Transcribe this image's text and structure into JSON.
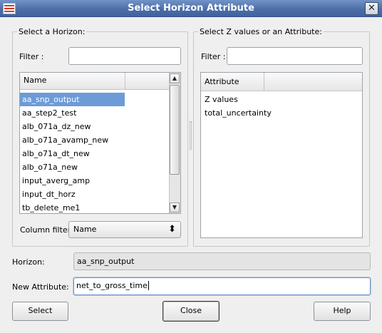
{
  "window": {
    "title": "Select Horizon Attribute",
    "close_glyph": "✕"
  },
  "left_group": {
    "title": "Select a Horizon:",
    "filter_label": "Filter :",
    "filter_value": "",
    "column_header": "Name",
    "items": [
      "aa_snp_output",
      "aa_step2_test",
      "alb_071a_dz_new",
      "alb_o71a_avamp_new",
      "alb_o71a_dt_new",
      "alb_o71a_new",
      "input_averg_amp",
      "input_dt_horz",
      "tb_delete_me1"
    ],
    "selected_index": 0,
    "column_filter_label": "Column filter:",
    "column_filter_value": "Name"
  },
  "right_group": {
    "title": "Select Z values or an Attribute:",
    "filter_label": "Filter :",
    "filter_value": "",
    "column_header": "Attribute",
    "items": [
      "Z values",
      "total_uncertainty"
    ]
  },
  "form": {
    "horizon_label": "Horizon:",
    "horizon_value": "aa_snp_output",
    "new_attribute_label": "New Attribute:",
    "new_attribute_value": "net_to_gross_time"
  },
  "buttons": {
    "select": "Select",
    "close": "Close",
    "help": "Help"
  },
  "icons": {
    "app": "horizon-app-icon",
    "scroll_up": "▲",
    "scroll_down": "▼",
    "combo_arrows": "⬍"
  }
}
